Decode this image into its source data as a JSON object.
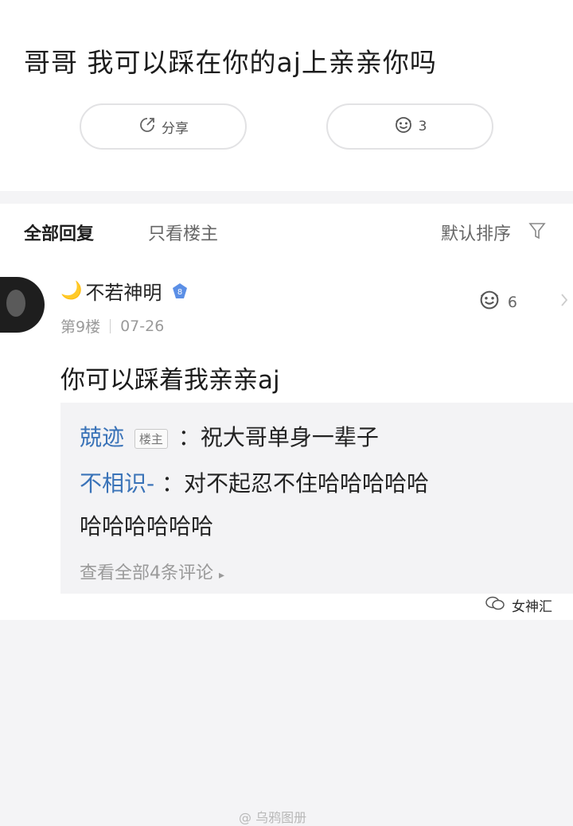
{
  "post": {
    "text": "哥哥 我可以踩在你的aj上亲亲你吗",
    "share_label": "分享",
    "like_count": "3"
  },
  "tabs": {
    "all": "全部回复",
    "owner_only": "只看楼主"
  },
  "sort_label": "默认排序",
  "reply": {
    "username": "不若神明",
    "badge_level": "8",
    "floor": "第9楼",
    "date": "07-26",
    "like_count": "6",
    "text": "你可以踩着我亲亲aj",
    "sub_replies": [
      {
        "user": "兢迹",
        "tag": "楼主",
        "text": "：祝大哥单身一辈子"
      },
      {
        "user": "不相识-",
        "text": "：对不起忍不住哈哈哈哈哈"
      },
      {
        "continuation": "哈哈哈哈哈哈"
      }
    ],
    "view_all": "查看全部4条评论"
  },
  "watermarks": {
    "wechat": "女神汇",
    "weibo": "@ 乌鸦图册"
  },
  "colors": {
    "link_blue": "#3a73b8",
    "badge_blue": "#5b8fe6",
    "moon_yellow": "#e4b43a"
  }
}
